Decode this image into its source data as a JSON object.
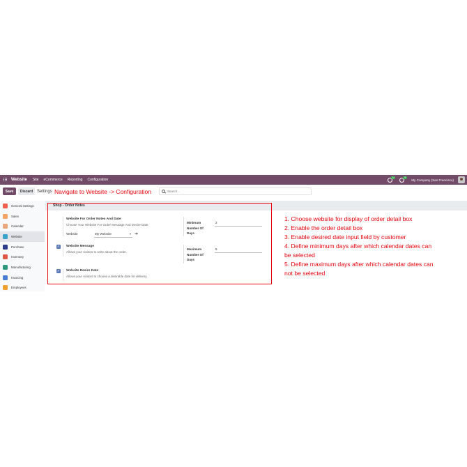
{
  "navbar": {
    "brand": "Website",
    "menu": [
      "Site",
      "eCommerce",
      "Reporting",
      "Configuration"
    ],
    "chat_badge": "34",
    "activity_badge": "25",
    "company": "My Company (San Francisco)"
  },
  "control": {
    "save_label": "Save",
    "discard_label": "Discard",
    "breadcrumb": "Settings",
    "annotation": "Navigate to Website -> Configuration",
    "search_placeholder": "Search..."
  },
  "sidebar": {
    "items": [
      {
        "label": "General Settings",
        "icon": "general-settings-icon",
        "color": "#f06050",
        "active": false
      },
      {
        "label": "Sales",
        "icon": "sales-icon",
        "color": "#f4a460",
        "active": false
      },
      {
        "label": "Calendar",
        "icon": "calendar-icon",
        "color": "#e8a87c",
        "active": false
      },
      {
        "label": "Website",
        "icon": "website-icon",
        "color": "#3aa3c9",
        "active": true
      },
      {
        "label": "Purchase",
        "icon": "purchase-icon",
        "color": "#2c3e8c",
        "active": false
      },
      {
        "label": "Inventory",
        "icon": "inventory-icon",
        "color": "#e05a47",
        "active": false
      },
      {
        "label": "Manufacturing",
        "icon": "manufacturing-icon",
        "color": "#2e9a7d",
        "active": false
      },
      {
        "label": "Invoicing",
        "icon": "invoicing-icon",
        "color": "#4a7fd4",
        "active": false
      },
      {
        "label": "Employees",
        "icon": "employees-icon",
        "color": "#f0a030",
        "active": false
      }
    ]
  },
  "section": {
    "title": "Shop - Order Notes",
    "order_notes_title": "Website For Order Notes And Date",
    "order_notes_desc": "Choose Your Website For Order Message And Desire Date",
    "website_label": "Website",
    "website_value": "My Website",
    "min_days_label": "Minimum Number Of Days",
    "min_days_value": "2",
    "message_title": "Website Message",
    "message_desc": "Allows your visitors to write about the order.",
    "max_days_label": "Maximum Number Of Days",
    "max_days_value": "5",
    "desire_date_title": "Website Desire Date",
    "desire_date_desc": "Allows your visitors to choose a desirable date for delivery."
  },
  "notes": [
    "1. Choose website for display of order detail box",
    "2. Enable the order detail box",
    "3. Enable desired date input field by customer",
    "4. Define minimum days after which calendar dates can be selected",
    "5. Define maximum days after which calendar dates can not be selected"
  ],
  "colors": {
    "brand": "#714b67",
    "annotation": "#e8000b",
    "checkbox": "#5f7bb7"
  }
}
